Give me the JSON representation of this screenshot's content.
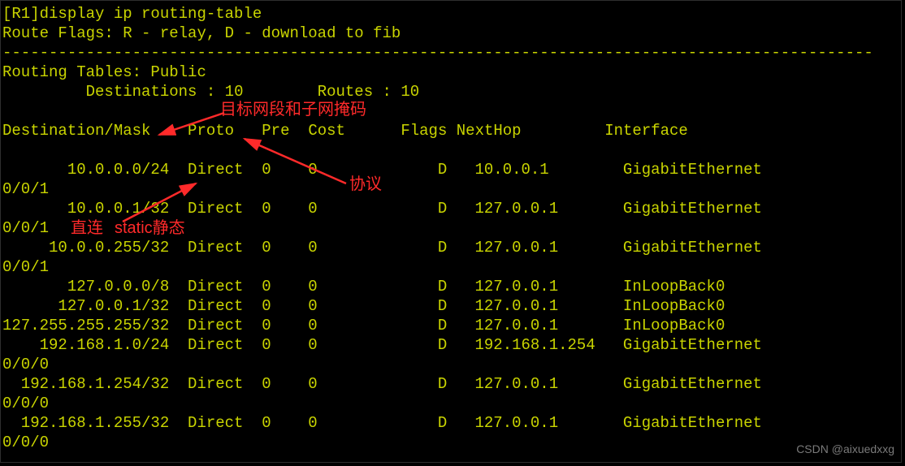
{
  "prompt": "[R1]display ip routing-table",
  "flags_line": "Route Flags: R - relay, D - download to fib",
  "separator": "----------------------------------------------------------------------------------------------",
  "tables_label": "Routing Tables: Public",
  "dest_count_label": "Destinations :",
  "dest_count": "10",
  "routes_count_label": "Routes :",
  "routes_count": "10",
  "headers": {
    "dest": "Destination/Mask",
    "proto": "Proto",
    "pre": "Pre",
    "cost": "Cost",
    "flags": "Flags",
    "nexthop": "NextHop",
    "interface": "Interface"
  },
  "rows": [
    {
      "dest": "10.0.0.0/24",
      "proto": "Direct",
      "pre": "0",
      "cost": "0",
      "flags": "D",
      "nexthop": "10.0.0.1",
      "iface": "GigabitEthernet",
      "iface2": "0/0/1"
    },
    {
      "dest": "10.0.0.1/32",
      "proto": "Direct",
      "pre": "0",
      "cost": "0",
      "flags": "D",
      "nexthop": "127.0.0.1",
      "iface": "GigabitEthernet",
      "iface2": "0/0/1"
    },
    {
      "dest": "10.0.0.255/32",
      "proto": "Direct",
      "pre": "0",
      "cost": "0",
      "flags": "D",
      "nexthop": "127.0.0.1",
      "iface": "GigabitEthernet",
      "iface2": "0/0/1"
    },
    {
      "dest": "127.0.0.0/8",
      "proto": "Direct",
      "pre": "0",
      "cost": "0",
      "flags": "D",
      "nexthop": "127.0.0.1",
      "iface": "InLoopBack0",
      "iface2": ""
    },
    {
      "dest": "127.0.0.1/32",
      "proto": "Direct",
      "pre": "0",
      "cost": "0",
      "flags": "D",
      "nexthop": "127.0.0.1",
      "iface": "InLoopBack0",
      "iface2": ""
    },
    {
      "dest": "127.255.255.255/32",
      "proto": "Direct",
      "pre": "0",
      "cost": "0",
      "flags": "D",
      "nexthop": "127.0.0.1",
      "iface": "InLoopBack0",
      "iface2": ""
    },
    {
      "dest": "192.168.1.0/24",
      "proto": "Direct",
      "pre": "0",
      "cost": "0",
      "flags": "D",
      "nexthop": "192.168.1.254",
      "iface": "GigabitEthernet",
      "iface2": "0/0/0"
    },
    {
      "dest": "192.168.1.254/32",
      "proto": "Direct",
      "pre": "0",
      "cost": "0",
      "flags": "D",
      "nexthop": "127.0.0.1",
      "iface": "GigabitEthernet",
      "iface2": "0/0/0"
    },
    {
      "dest": "192.168.1.255/32",
      "proto": "Direct",
      "pre": "0",
      "cost": "0",
      "flags": "D",
      "nexthop": "127.0.0.1",
      "iface": "GigabitEthernet",
      "iface2": "0/0/0"
    }
  ],
  "annotations": {
    "dest_mask": "目标网段和子网掩码",
    "protocol": "协议",
    "direct": "直连",
    "static": "static静态"
  },
  "watermark": "CSDN @aixuedxxg"
}
